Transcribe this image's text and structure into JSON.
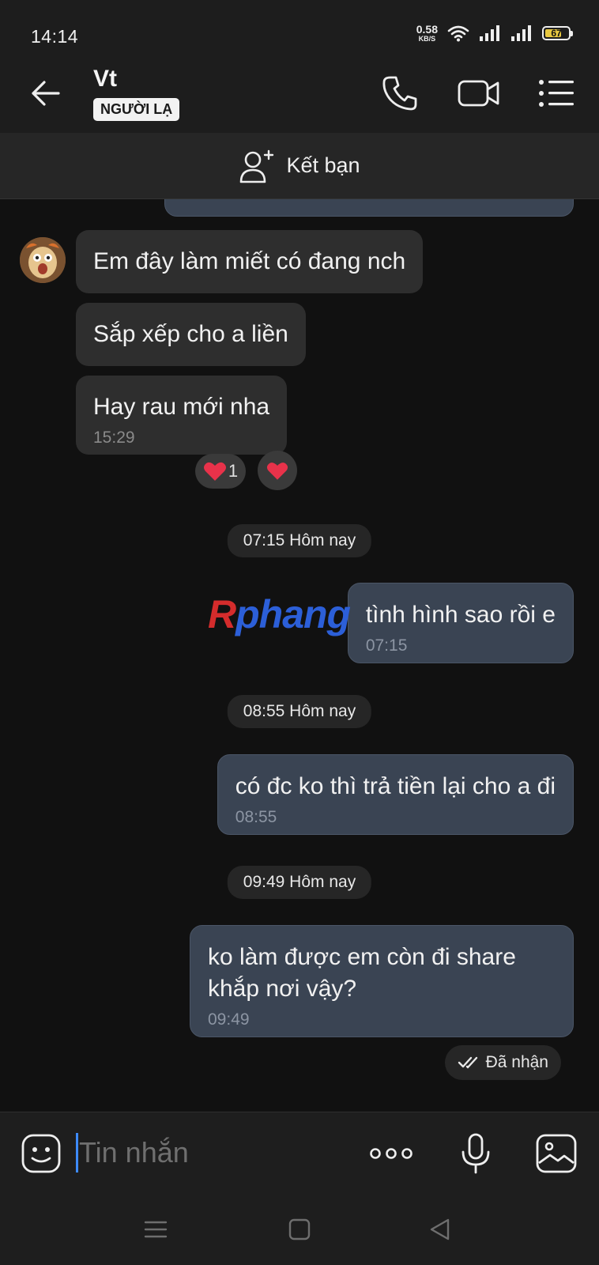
{
  "status_bar": {
    "time": "14:14",
    "net_speed": "0.58",
    "net_unit": "KB/S",
    "battery": "67"
  },
  "header": {
    "title": "Vt",
    "badge": "NGƯỜI LẠ"
  },
  "add_friend": {
    "label": "Kết bạn"
  },
  "messages": {
    "in_1": {
      "text": "Em đây làm miết có đang nch"
    },
    "in_2": {
      "text": "Sắp xếp cho a liền"
    },
    "in_3": {
      "text": "Hay rau mới nha",
      "time": "15:29"
    },
    "reaction_count": "1",
    "sep_1": "07:15 Hôm nay",
    "out_1": {
      "text": "tình hình sao rồi e",
      "time": "07:15"
    },
    "sep_2": "08:55 Hôm nay",
    "out_2": {
      "text": "có đc ko thì trả tiền lại cho a đi",
      "time": "08:55"
    },
    "sep_3": "09:49 Hôm nay",
    "out_3": {
      "text": "ko làm được em còn đi share khắp nơi vậy?",
      "time": "09:49"
    },
    "status": "Đã nhận"
  },
  "watermark": {
    "r": "R",
    "rest": "phang"
  },
  "input": {
    "placeholder": "Tin nhắn"
  },
  "colors": {
    "accent": "#3D8BFF",
    "heart": "#E8324A",
    "outgoing_bubble": "#3A4453",
    "incoming_bubble": "#2E2E2E"
  }
}
